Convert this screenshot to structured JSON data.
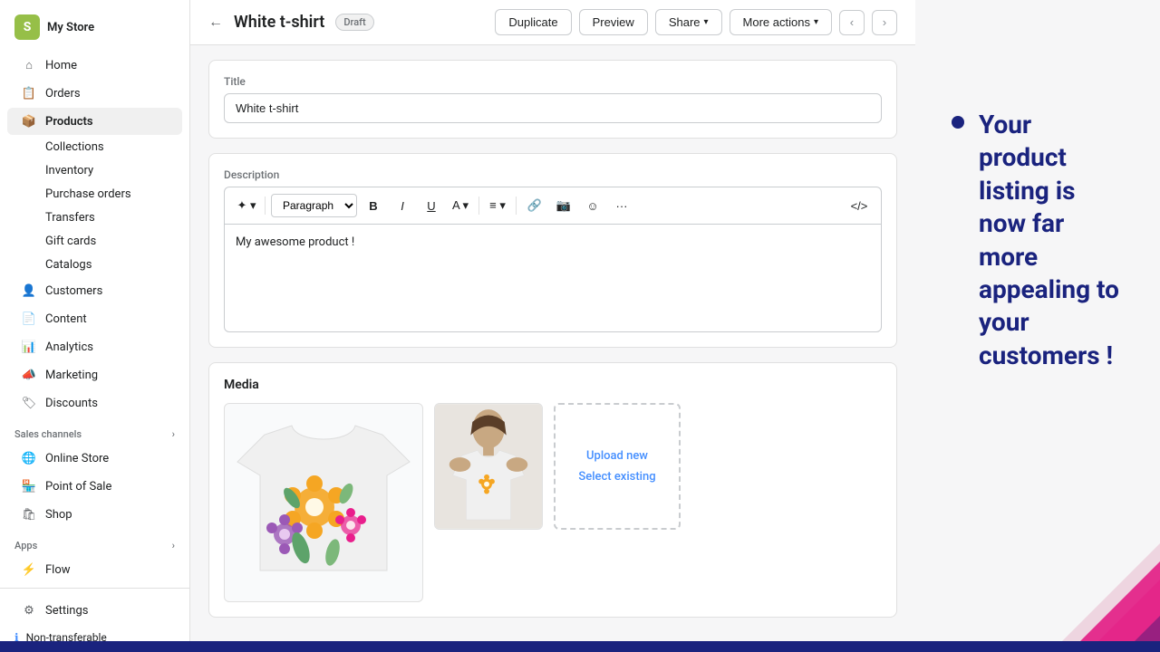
{
  "sidebar": {
    "store": "My Store",
    "nav": [
      {
        "id": "home",
        "label": "Home",
        "icon": "home"
      },
      {
        "id": "orders",
        "label": "Orders",
        "icon": "orders"
      },
      {
        "id": "products",
        "label": "Products",
        "icon": "products",
        "active": true
      }
    ],
    "sub_nav": [
      {
        "id": "collections",
        "label": "Collections"
      },
      {
        "id": "inventory",
        "label": "Inventory"
      },
      {
        "id": "purchase-orders",
        "label": "Purchase orders"
      },
      {
        "id": "transfers",
        "label": "Transfers"
      },
      {
        "id": "gift-cards",
        "label": "Gift cards"
      },
      {
        "id": "catalogs",
        "label": "Catalogs"
      }
    ],
    "nav2": [
      {
        "id": "customers",
        "label": "Customers",
        "icon": "customers"
      },
      {
        "id": "content",
        "label": "Content",
        "icon": "content"
      },
      {
        "id": "analytics",
        "label": "Analytics",
        "icon": "analytics"
      },
      {
        "id": "marketing",
        "label": "Marketing",
        "icon": "marketing"
      },
      {
        "id": "discounts",
        "label": "Discounts",
        "icon": "discounts"
      }
    ],
    "sales_channels_label": "Sales channels",
    "sales_channels": [
      {
        "id": "online-store",
        "label": "Online Store"
      },
      {
        "id": "pos",
        "label": "Point of Sale"
      },
      {
        "id": "shop",
        "label": "Shop"
      }
    ],
    "apps_label": "Apps",
    "apps": [
      {
        "id": "flow",
        "label": "Flow"
      }
    ],
    "settings_label": "Settings",
    "non_transferable": "Non-transferable"
  },
  "topbar": {
    "back_label": "←",
    "title": "White t-shirt",
    "badge": "Draft",
    "actions": {
      "duplicate": "Duplicate",
      "preview": "Preview",
      "share": "Share",
      "more_actions": "More actions"
    }
  },
  "product": {
    "title_label": "Title",
    "title_value": "White t-shirt",
    "description_label": "Description",
    "description_value": "My awesome product !",
    "toolbar": {
      "paragraph_label": "Paragraph",
      "bold": "B",
      "italic": "I",
      "underline": "U",
      "font_color": "A"
    },
    "media_label": "Media",
    "upload_new": "Upload new",
    "select_existing": "Select existing"
  },
  "info_panel": {
    "bullet_text": "Your product listing is now far more appealing to your customers !"
  }
}
